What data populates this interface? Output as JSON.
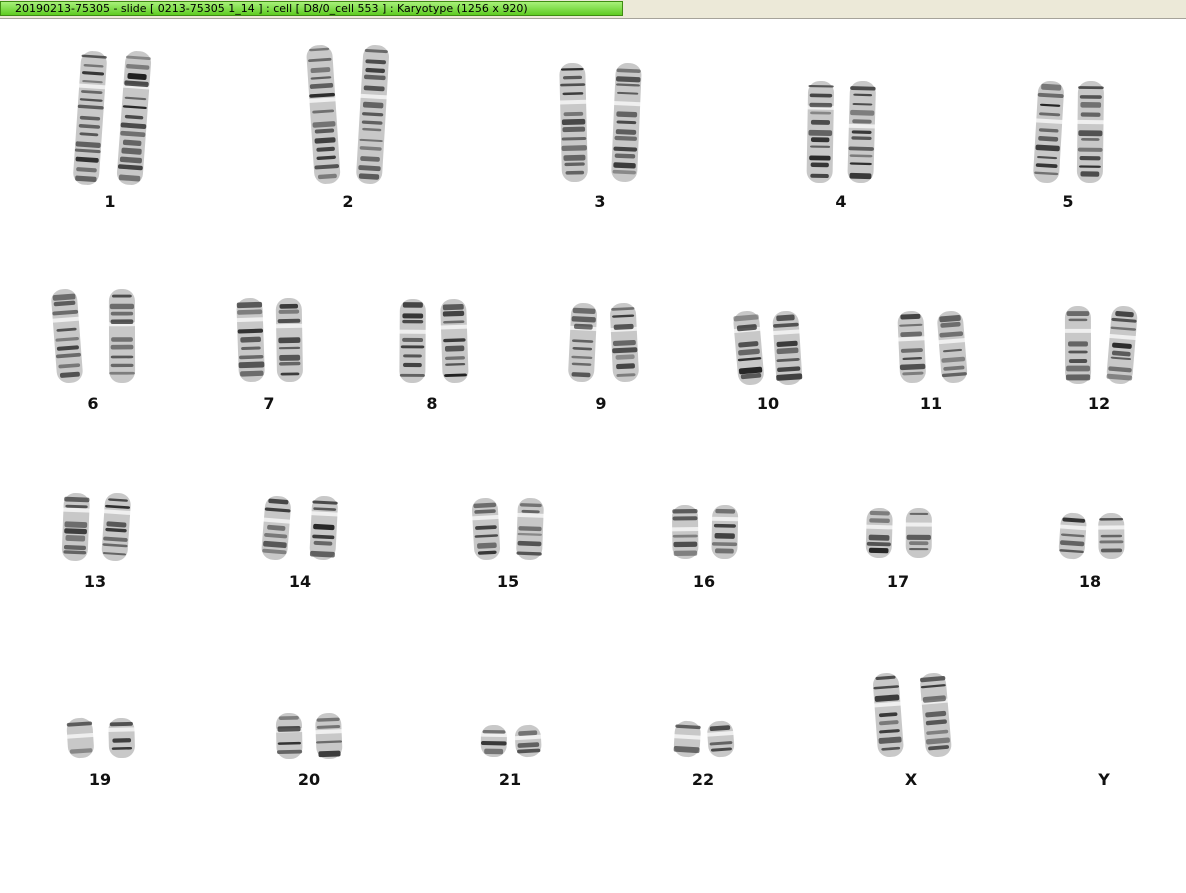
{
  "window": {
    "title": "20190213-75305 - slide [ 0213-75305 1_14 ] : cell [ D8/0_cell 553 ] : Karyotype  (1256 x 920)"
  },
  "karyotype": {
    "chromosomes": [
      {
        "label": "1"
      },
      {
        "label": "2"
      },
      {
        "label": "3"
      },
      {
        "label": "4"
      },
      {
        "label": "5"
      },
      {
        "label": "6"
      },
      {
        "label": "7"
      },
      {
        "label": "8"
      },
      {
        "label": "9"
      },
      {
        "label": "10"
      },
      {
        "label": "11"
      },
      {
        "label": "12"
      },
      {
        "label": "13"
      },
      {
        "label": "14"
      },
      {
        "label": "15"
      },
      {
        "label": "16"
      },
      {
        "label": "17"
      },
      {
        "label": "18"
      },
      {
        "label": "19"
      },
      {
        "label": "20"
      },
      {
        "label": "21"
      },
      {
        "label": "22"
      },
      {
        "label": "X"
      },
      {
        "label": "Y"
      }
    ]
  }
}
